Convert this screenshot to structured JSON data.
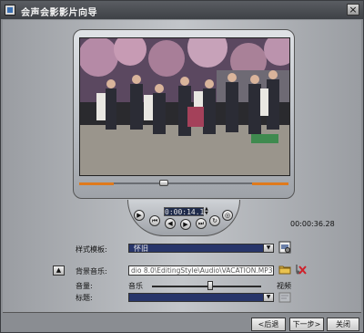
{
  "window": {
    "title": "会声会影影片向导",
    "close_label": "×"
  },
  "preview": {
    "timecode": "0:00:14.15",
    "duration": "00:00:36.28",
    "controls": [
      {
        "name": "play-icon",
        "glyph": "▶"
      },
      {
        "name": "home-icon",
        "glyph": "⏮"
      },
      {
        "name": "prev-frame-icon",
        "glyph": "◀"
      },
      {
        "name": "next-frame-icon",
        "glyph": "▶"
      },
      {
        "name": "end-icon",
        "glyph": "⏭"
      },
      {
        "name": "repeat-icon",
        "glyph": "↻"
      }
    ],
    "spin_up": "▲",
    "spin_down": "▼"
  },
  "form": {
    "template_label": "样式模板:",
    "template_value": "怀旧",
    "bgmusic_label": "背景音乐:",
    "bgmusic_value": "dio 8.0\\EditingStyle\\Audio\\VACATION.MP3",
    "volume_label": "音量:",
    "volume_left": "音乐",
    "volume_right": "视频",
    "title_label": "标题:",
    "title_value": "",
    "collapse_label": "▲",
    "dropdown_arrow": "▼"
  },
  "footer": {
    "back_label": "<后退",
    "next_label": "下一步>",
    "close_label": "关闭"
  },
  "colors": {
    "accent_orange": "#e07a1c",
    "combo_blue": "#27356a"
  }
}
